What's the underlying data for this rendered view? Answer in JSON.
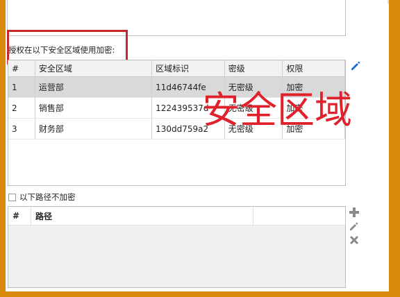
{
  "auth_label": "授权在以下安全区域使用加密:",
  "zones_table": {
    "columns": [
      "#",
      "安全区域",
      "区域标识",
      "密级",
      "权限"
    ],
    "rows": [
      {
        "num": "1",
        "name": "运营部",
        "id": "11d46744fe",
        "level": "无密级",
        "perm": "加密",
        "selected": true
      },
      {
        "num": "2",
        "name": "销售部",
        "id": "122439537d",
        "level": "无密级",
        "perm": "加密",
        "selected": false
      },
      {
        "num": "3",
        "name": "财务部",
        "id": "130dd759a2",
        "level": "无密级",
        "perm": "加密",
        "selected": false
      }
    ]
  },
  "overlay_annotation": "安全区域",
  "exclude_checkbox_label": "以下路径不加密",
  "exclude_checked": false,
  "paths_table": {
    "columns": [
      "#",
      "路径",
      ""
    ]
  },
  "icons": {
    "edit": "pencil-icon",
    "add": "plus-icon",
    "edit_path": "pencil-icon",
    "delete": "close-icon"
  },
  "colors": {
    "frame": "#d98a0a",
    "annotation": "#e0202a",
    "accent_icon": "#1a6fd1"
  }
}
